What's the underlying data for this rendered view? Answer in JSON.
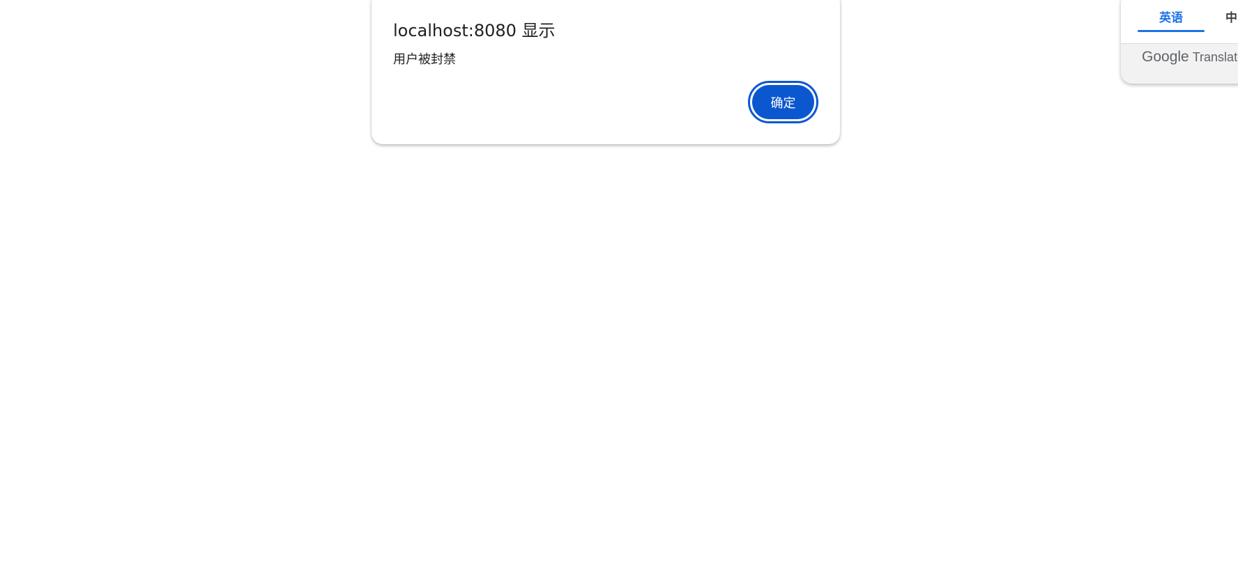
{
  "dialog": {
    "title": "localhost:8080 显示",
    "message": "用户被封禁",
    "ok_label": "确定"
  },
  "translate_popup": {
    "tabs": [
      {
        "label": "英语",
        "active": true
      },
      {
        "label": "中"
      }
    ],
    "brand_google": "Google",
    "brand_translate": "Translate"
  },
  "colors": {
    "accent": "#0b57d0",
    "tab_active": "#1a73e8"
  }
}
